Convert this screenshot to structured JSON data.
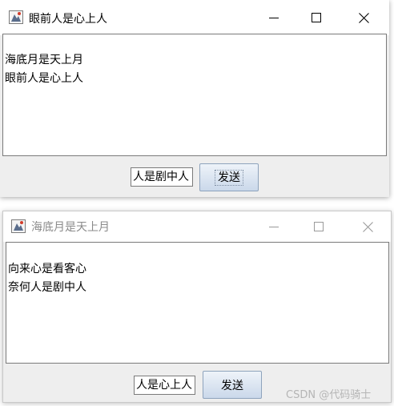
{
  "windows": [
    {
      "title": "眼前人是心上人",
      "icon": "java-app-icon",
      "controls": {
        "minimize": "minimize-icon",
        "maximize": "maximize-icon",
        "close": "close-icon"
      },
      "chat_lines": [
        "海底月是天上月",
        "眼前人是心上人"
      ],
      "input_value": "人是剧中人",
      "send_label": "发送",
      "active": true
    },
    {
      "title": "海底月是天上月",
      "icon": "java-app-icon",
      "controls": {
        "minimize": "minimize-icon",
        "maximize": "maximize-icon",
        "close": "close-icon"
      },
      "chat_lines": [
        "向来心是看客心",
        "奈何人是剧中人"
      ],
      "input_value": "人是心上人",
      "send_label": "发送",
      "active": false
    }
  ],
  "watermark": "CSDN @代码骑士",
  "colors": {
    "button_top": "#eef3f9",
    "button_bottom": "#cad8ea",
    "inactive_title": "#8a8a8a"
  }
}
